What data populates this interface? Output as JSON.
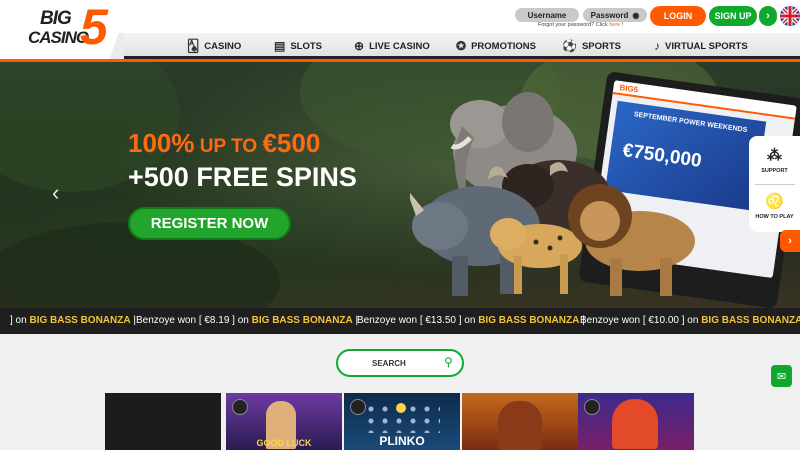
{
  "brand": {
    "logo_big": "BIG",
    "logo_casino": "CASINO",
    "logo_five": "5",
    "accent": "#ff5a00",
    "green": "#11a82e"
  },
  "auth": {
    "username_placeholder": "Username",
    "password_placeholder": "Password",
    "forgot_text": "Forgot your password? Click ",
    "forgot_link": "here",
    "forgot_suffix": " !",
    "login_label": "LOGIN",
    "signup_label": "SIGN UP",
    "next_label": "›"
  },
  "nav": {
    "items": [
      {
        "label": "CASINO",
        "icon": "cards-icon"
      },
      {
        "label": "SLOTS",
        "icon": "slot-machine-icon"
      },
      {
        "label": "LIVE CASINO",
        "icon": "globe-icon"
      },
      {
        "label": "PROMOTIONS",
        "icon": "chip-icon"
      },
      {
        "label": "SPORTS",
        "icon": "runner-icon"
      },
      {
        "label": "VIRTUAL SPORTS",
        "icon": "whistle-icon"
      }
    ]
  },
  "hero": {
    "line1_main": "100%",
    "line1_small": " UP TO ",
    "line1_amount": "€500",
    "line2": "+500 FREE SPINS",
    "cta": "REGISTER NOW",
    "prev": "‹",
    "laptop_brand": "BIG5",
    "laptop_promo": "SEPTEMBER POWER WEEKENDS",
    "laptop_amount": "€750,000"
  },
  "side": {
    "support": "SUPPORT",
    "howto": "HOW TO PLAY",
    "arrow": "›"
  },
  "ticker": [
    {
      "prefix": "] on ",
      "game": "BIG BASS BONANZA",
      "suffix": "  |"
    },
    {
      "prefix": "Benzoye won [ €8.19 ] on ",
      "game": "BIG BASS BONANZA",
      "suffix": "  |"
    },
    {
      "prefix": "Benzoye won [ €13.50 ] on ",
      "game": "BIG BASS BONANZA",
      "suffix": "  |"
    },
    {
      "prefix": "Benzoye won [ €10.00 ] on ",
      "game": "BIG BASS BONANZA",
      "suffix": ""
    }
  ],
  "search": {
    "placeholder": "SEARCH"
  },
  "tiles": [
    {
      "label": ""
    },
    {
      "label": "GOOD LUCK"
    },
    {
      "label": "PLINKO"
    },
    {
      "label": ""
    },
    {
      "label": ""
    }
  ]
}
